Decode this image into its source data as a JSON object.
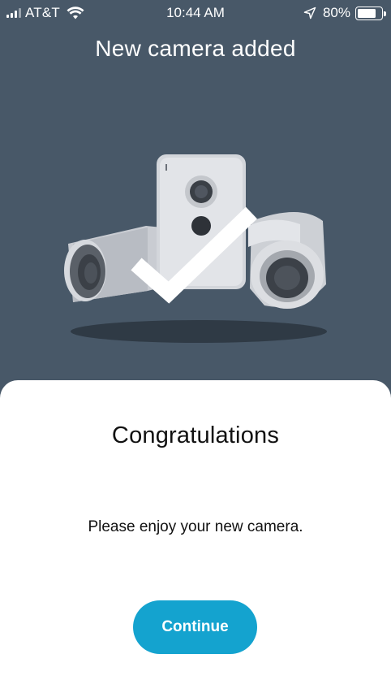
{
  "status_bar": {
    "carrier": "AT&T",
    "time": "10:44 AM",
    "battery": "80%",
    "battery_level": 0.8,
    "icons": [
      "signal-icon",
      "wifi-icon",
      "location-arrow-icon",
      "battery-icon"
    ]
  },
  "header": {
    "title": "New camera added"
  },
  "illustration": {
    "icon": "cameras-with-checkmark-illustration"
  },
  "sheet": {
    "heading": "Congratulations",
    "message": "Please enjoy your new camera.",
    "continue_label": "Continue"
  },
  "colors": {
    "background": "#485868",
    "accent": "#14a3cf",
    "sheet": "#ffffff"
  }
}
